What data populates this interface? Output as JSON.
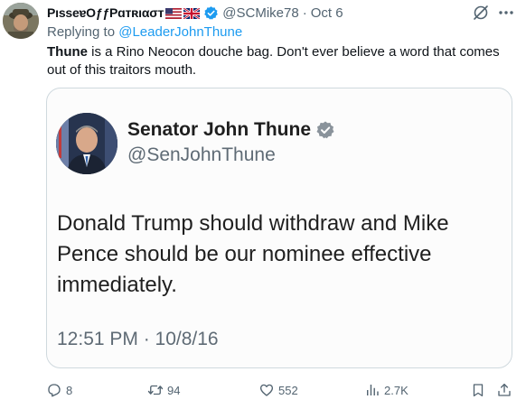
{
  "author": {
    "display_name": "PısseɐΟƒƒPɑтʀıασт",
    "handle": "@SCMike78",
    "date": "Oct 6",
    "separator": "·"
  },
  "reply": {
    "prefix": "Replying to",
    "mention": "@LeaderJohnThune"
  },
  "tweet": {
    "bold_word": "Thune",
    "text": " is a Rino Neocon douche bag.  Don't ever believe a word that comes out of this traitors mouth."
  },
  "embedded_post": {
    "name": "Senator John Thune",
    "handle": "@SenJohnThune",
    "text": "Donald Trump should withdraw and Mike Pence should be our nominee effective immediately.",
    "time": "12:51 PM · 10/8/16"
  },
  "actions": {
    "replies": "8",
    "reposts": "94",
    "likes": "552",
    "views": "2.7K"
  },
  "colors": {
    "accent": "#1d9bf0",
    "muted_text": "#536471",
    "primary_text": "#0f1419",
    "border": "#cfd9de"
  },
  "icons": [
    "us-flag-icon",
    "uk-flag-icon",
    "verified-badge-icon",
    "grok-icon",
    "more-icon",
    "reply-icon",
    "repost-icon",
    "like-icon",
    "views-icon",
    "bookmark-icon",
    "share-icon"
  ]
}
